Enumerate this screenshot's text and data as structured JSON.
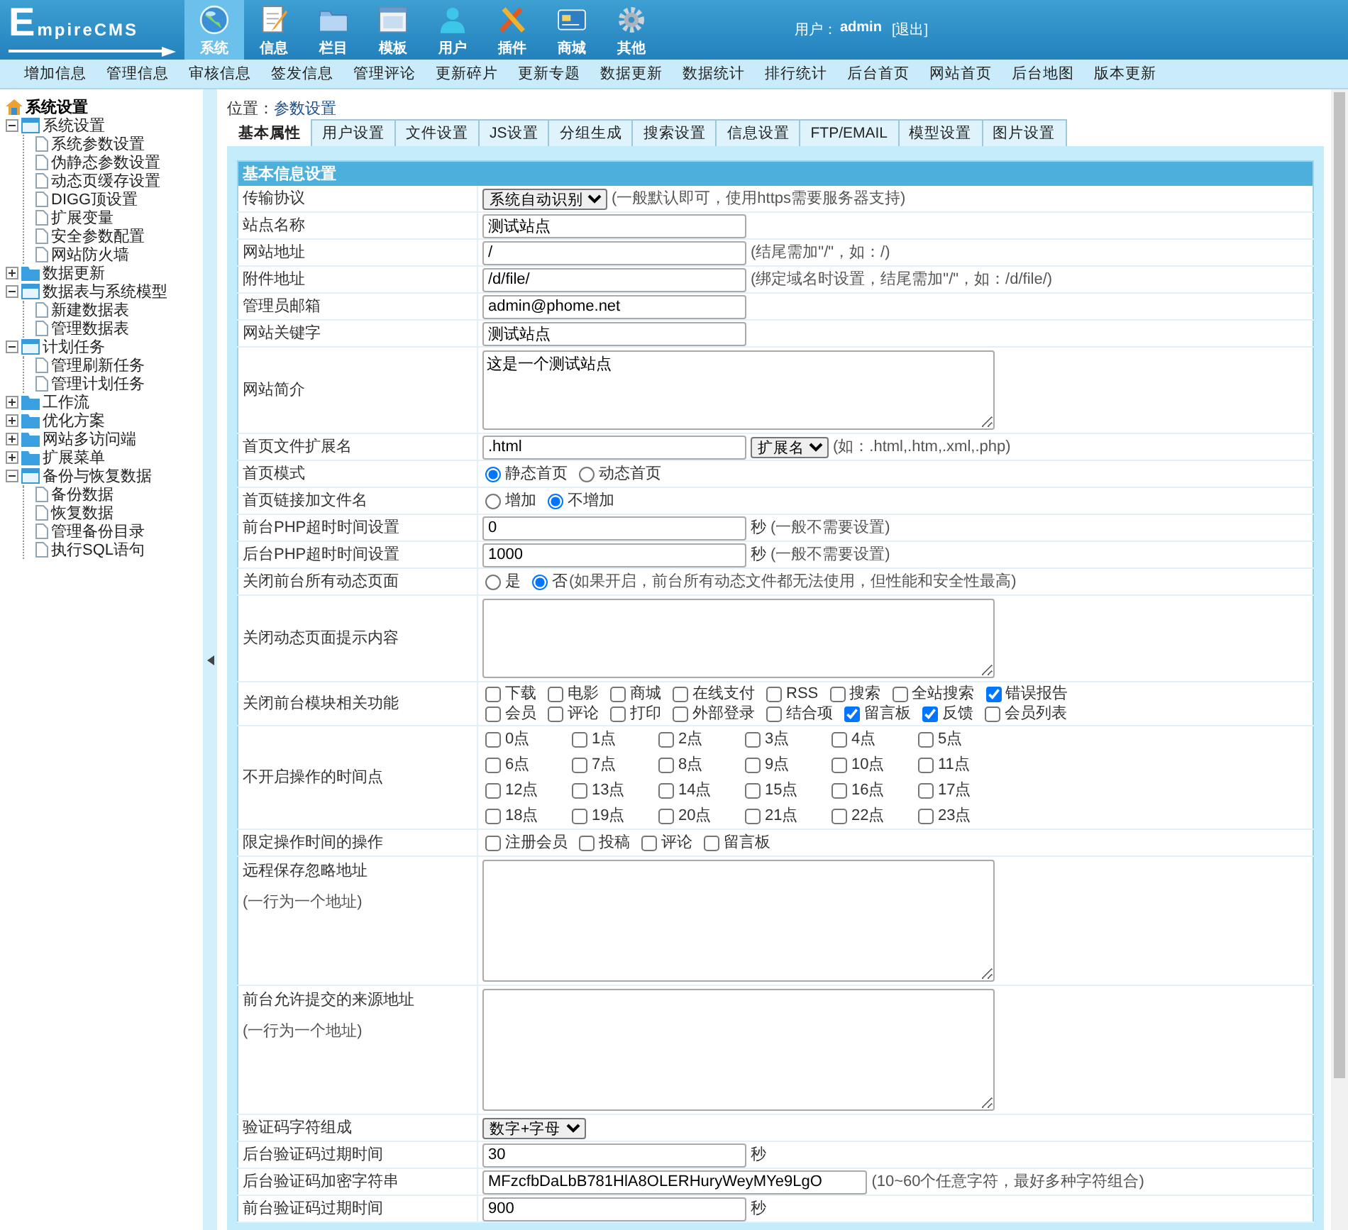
{
  "header": {
    "logo": "EmpireCMS",
    "nav": [
      {
        "label": "系统",
        "selected": true
      },
      {
        "label": "信息",
        "selected": false
      },
      {
        "label": "栏目",
        "selected": false
      },
      {
        "label": "模板",
        "selected": false
      },
      {
        "label": "用户",
        "selected": false
      },
      {
        "label": "插件",
        "selected": false
      },
      {
        "label": "商城",
        "selected": false
      },
      {
        "label": "其他",
        "selected": false
      }
    ],
    "user_label": "用户：",
    "user_name": "admin",
    "logout": "[退出]"
  },
  "subnav": [
    "增加信息",
    "管理信息",
    "审核信息",
    "签发信息",
    "管理评论",
    "更新碎片",
    "更新专题",
    "数据更新",
    "数据统计",
    "排行统计",
    "后台首页",
    "网站首页",
    "后台地图",
    "版本更新"
  ],
  "sidebar": {
    "title": "系统设置",
    "items": [
      {
        "label": "系统设置",
        "expanded": true,
        "children": [
          {
            "label": "系统参数设置"
          },
          {
            "label": "伪静态参数设置"
          },
          {
            "label": "动态页缓存设置"
          },
          {
            "label": "DIGG顶设置"
          },
          {
            "label": "扩展变量"
          },
          {
            "label": "安全参数配置"
          },
          {
            "label": "网站防火墙"
          }
        ]
      },
      {
        "label": "数据更新",
        "expanded": false
      },
      {
        "label": "数据表与系统模型",
        "expanded": true,
        "children": [
          {
            "label": "新建数据表"
          },
          {
            "label": "管理数据表"
          }
        ]
      },
      {
        "label": "计划任务",
        "expanded": true,
        "children": [
          {
            "label": "管理刷新任务"
          },
          {
            "label": "管理计划任务"
          }
        ]
      },
      {
        "label": "工作流",
        "expanded": false
      },
      {
        "label": "优化方案",
        "expanded": false
      },
      {
        "label": "网站多访问端",
        "expanded": false
      },
      {
        "label": "扩展菜单",
        "expanded": false
      },
      {
        "label": "备份与恢复数据",
        "expanded": true,
        "children": [
          {
            "label": "备份数据"
          },
          {
            "label": "恢复数据"
          },
          {
            "label": "管理备份目录"
          },
          {
            "label": "执行SQL语句"
          }
        ]
      }
    ]
  },
  "location": {
    "label": "位置：",
    "link": "参数设置"
  },
  "tabs": [
    {
      "label": "基本属性",
      "selected": true
    },
    {
      "label": "用户设置",
      "selected": false
    },
    {
      "label": "文件设置",
      "selected": false
    },
    {
      "label": "JS设置",
      "selected": false
    },
    {
      "label": "分组生成",
      "selected": false
    },
    {
      "label": "搜索设置",
      "selected": false
    },
    {
      "label": "信息设置",
      "selected": false
    },
    {
      "label": "FTP/EMAIL",
      "selected": false
    },
    {
      "label": "模型设置",
      "selected": false
    },
    {
      "label": "图片设置",
      "selected": false
    }
  ],
  "form": {
    "title": "基本信息设置",
    "rows": [
      {
        "label": "传输协议",
        "kind": "select",
        "value": "系统自动识别",
        "hint": "(一般默认即可，使用https需要服务器支持)"
      },
      {
        "label": "站点名称",
        "kind": "text",
        "value": "测试站点"
      },
      {
        "label": "网站地址",
        "kind": "text",
        "value": "/",
        "hint": "(结尾需加\"/\"，如：/)"
      },
      {
        "label": "附件地址",
        "kind": "text",
        "value": "/d/file/",
        "hint": "(绑定域名时设置，结尾需加\"/\"，如：/d/file/)"
      },
      {
        "label": "管理员邮箱",
        "kind": "text",
        "value": "admin@phome.net"
      },
      {
        "label": "网站关键字",
        "kind": "text",
        "value": "测试站点"
      },
      {
        "label": "网站简介",
        "kind": "textarea",
        "value": "这是一个测试站点"
      },
      {
        "label": "首页文件扩展名",
        "kind": "text",
        "value": ".html",
        "select": "扩展名",
        "hint": "(如：.html,.htm,.xml,.php)"
      },
      {
        "label": "首页模式",
        "kind": "radio",
        "options": [
          {
            "label": "静态首页",
            "selected": true
          },
          {
            "label": "动态首页",
            "selected": false
          }
        ]
      },
      {
        "label": "首页链接加文件名",
        "kind": "radio",
        "options": [
          {
            "label": "增加",
            "selected": false
          },
          {
            "label": "不增加",
            "selected": true
          }
        ]
      },
      {
        "label": "前台PHP超时时间设置",
        "kind": "text",
        "value": "0",
        "unit": "秒",
        "hint": "(一般不需要设置)"
      },
      {
        "label": "后台PHP超时时间设置",
        "kind": "text",
        "value": "1000",
        "unit": "秒",
        "hint": "(一般不需要设置)"
      },
      {
        "label": "关闭前台所有动态页面",
        "kind": "radio",
        "options": [
          {
            "label": "是",
            "selected": false
          },
          {
            "label": "否",
            "selected": true
          }
        ],
        "hint": "(如果开启，前台所有动态文件都无法使用，但性能和安全性最高)"
      },
      {
        "label": "关闭动态页面提示内容",
        "kind": "textarea"
      },
      {
        "label": "关闭前台模块相关功能",
        "kind": "checks",
        "lines": [
          [
            {
              "label": "下载",
              "checked": false
            },
            {
              "label": "电影",
              "checked": false
            },
            {
              "label": "商城",
              "checked": false
            },
            {
              "label": "在线支付",
              "checked": false
            },
            {
              "label": "RSS",
              "checked": false
            },
            {
              "label": "搜索",
              "checked": false
            },
            {
              "label": "全站搜索",
              "checked": false
            },
            {
              "label": "错误报告",
              "checked": true
            }
          ],
          [
            {
              "label": "会员",
              "checked": false
            },
            {
              "label": "评论",
              "checked": false
            },
            {
              "label": "打印",
              "checked": false
            },
            {
              "label": "外部登录",
              "checked": false
            },
            {
              "label": "结合项",
              "checked": false
            },
            {
              "label": "留言板",
              "checked": true
            },
            {
              "label": "反馈",
              "checked": true
            },
            {
              "label": "会员列表",
              "checked": false
            }
          ]
        ]
      },
      {
        "label": "不开启操作的时间点",
        "kind": "grid",
        "options": [
          {
            "label": "0点",
            "checked": false
          },
          {
            "label": "1点",
            "checked": false
          },
          {
            "label": "2点",
            "checked": false
          },
          {
            "label": "3点",
            "checked": false
          },
          {
            "label": "4点",
            "checked": false
          },
          {
            "label": "5点",
            "checked": false
          },
          {
            "label": "6点",
            "checked": false
          },
          {
            "label": "7点",
            "checked": false
          },
          {
            "label": "8点",
            "checked": false
          },
          {
            "label": "9点",
            "checked": false
          },
          {
            "label": "10点",
            "checked": false
          },
          {
            "label": "11点",
            "checked": false
          },
          {
            "label": "12点",
            "checked": false
          },
          {
            "label": "13点",
            "checked": false
          },
          {
            "label": "14点",
            "checked": false
          },
          {
            "label": "15点",
            "checked": false
          },
          {
            "label": "16点",
            "checked": false
          },
          {
            "label": "17点",
            "checked": false
          },
          {
            "label": "18点",
            "checked": false
          },
          {
            "label": "19点",
            "checked": false
          },
          {
            "label": "20点",
            "checked": false
          },
          {
            "label": "21点",
            "checked": false
          },
          {
            "label": "22点",
            "checked": false
          },
          {
            "label": "23点",
            "checked": false
          }
        ]
      },
      {
        "label": "限定操作时间的操作",
        "kind": "checks",
        "lines": [
          [
            {
              "label": "注册会员",
              "checked": false
            },
            {
              "label": "投稿",
              "checked": false
            },
            {
              "label": "评论",
              "checked": false
            },
            {
              "label": "留言板",
              "checked": false
            }
          ]
        ]
      },
      {
        "label": "远程保存忽略地址",
        "note": "(一行为一个地址)",
        "kind": "textarea"
      },
      {
        "label": "前台允许提交的来源地址",
        "note": "(一行为一个地址)",
        "kind": "textarea"
      },
      {
        "label": "验证码字符组成",
        "kind": "select",
        "value": "数字+字母"
      },
      {
        "label": "后台验证码过期时间",
        "kind": "text",
        "value": "30",
        "unit": "秒"
      },
      {
        "label": "后台验证码加密字符串",
        "kind": "text",
        "value": "MFzcfbDaLbB781HlA8OLERHuryWeyMYe9LgO",
        "hint": "(10~60个任意字符，最好多种字符组合)"
      },
      {
        "label": "前台验证码过期时间",
        "kind": "text",
        "value": "900",
        "unit": "秒"
      }
    ]
  }
}
